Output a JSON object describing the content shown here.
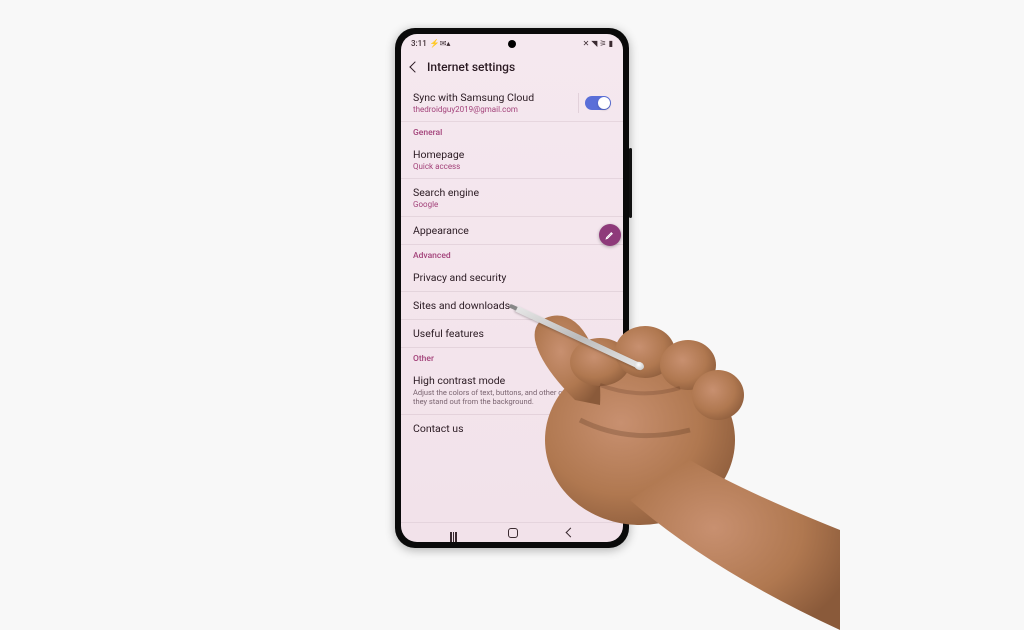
{
  "statusBar": {
    "time": "3:11",
    "icons": "⚡✉▴",
    "rightIcons": "✕ ◥ ⚞ ▮"
  },
  "header": {
    "title": "Internet settings"
  },
  "sync": {
    "title": "Sync with Samsung Cloud",
    "sub": "thedroidguy2019@gmail.com",
    "on": true
  },
  "sections": {
    "general": "General",
    "advanced": "Advanced",
    "other": "Other"
  },
  "rows": {
    "homepage": {
      "title": "Homepage",
      "sub": "Quick access"
    },
    "search": {
      "title": "Search engine",
      "sub": "Google"
    },
    "appearance": {
      "title": "Appearance"
    },
    "privacy": {
      "title": "Privacy and security"
    },
    "sites": {
      "title": "Sites and downloads"
    },
    "useful": {
      "title": "Useful features"
    },
    "highcontrast": {
      "title": "High contrast mode",
      "desc": "Adjust the colors of text, buttons, and other components so they stand out from the background.",
      "on": false
    },
    "contact": {
      "title": "Contact us"
    }
  }
}
